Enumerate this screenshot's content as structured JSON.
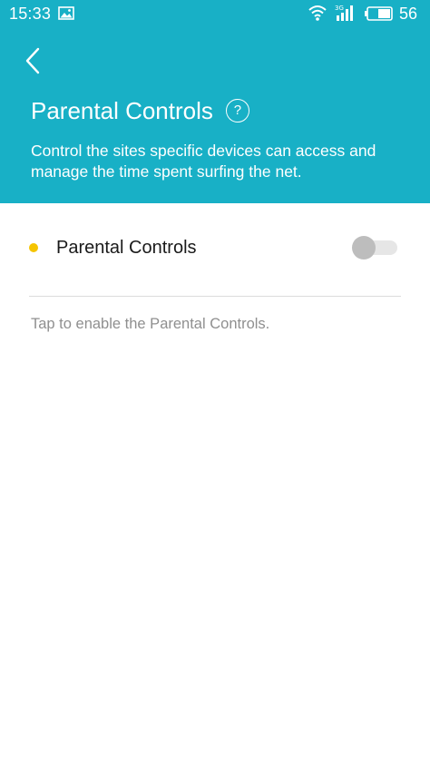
{
  "status_bar": {
    "time": "15:33",
    "battery_level": "56",
    "network_label": "3G",
    "icons": [
      "image-icon",
      "wifi-icon",
      "signal-icon",
      "battery-icon"
    ]
  },
  "header": {
    "back_icon": "chevron-left-icon",
    "title": "Parental Controls",
    "help_label": "?",
    "description": "Control the sites specific devices can access and manage the time spent surfing the net."
  },
  "setting": {
    "label": "Parental Controls",
    "enabled": false
  },
  "hint": "Tap to enable the Parental Controls.",
  "colors": {
    "accent": "#18b0c6",
    "dot": "#f5c400",
    "toggle_off_knob": "#bdbdbd",
    "toggle_off_track": "#e6e6e6",
    "hint_text": "#8f8f8f"
  }
}
